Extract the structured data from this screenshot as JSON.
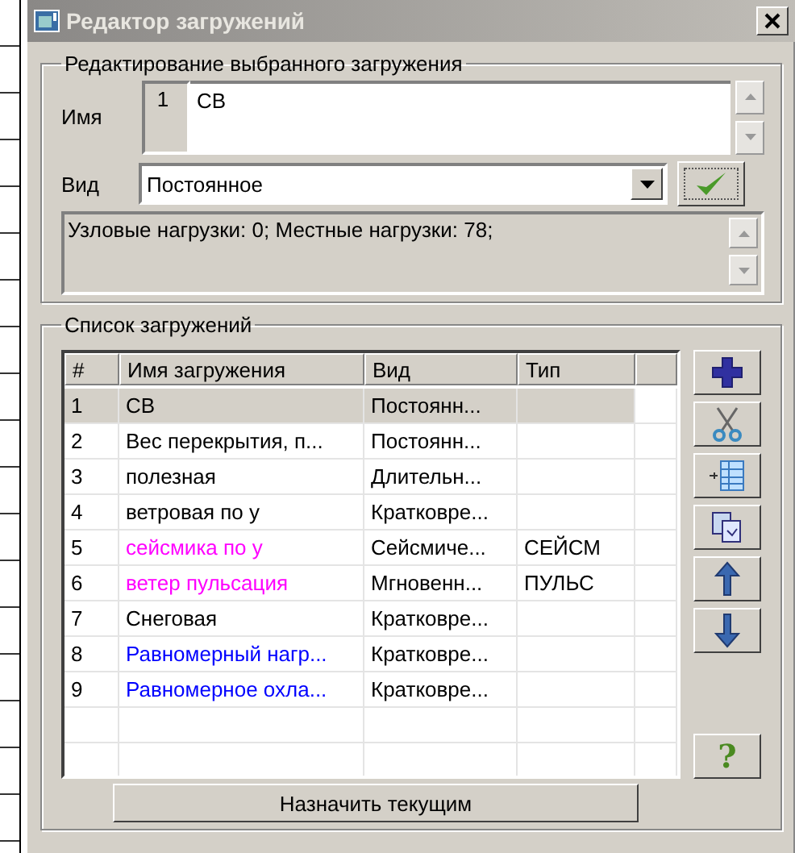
{
  "window": {
    "title": "Редактор загружений"
  },
  "edit_group": {
    "title": "Редактирование выбранного загружения",
    "name_label": "Имя",
    "number": "1",
    "name_value": "СВ",
    "kind_label": "Вид",
    "kind_value": "Постоянное",
    "info": "Узловые нагрузки:  0;  Местные нагрузки:  78;"
  },
  "list_group": {
    "title": "Список загружений",
    "table": {
      "columns": [
        "#",
        "Имя загружения",
        "Вид",
        "Тип"
      ],
      "rows": [
        {
          "cells": [
            "1",
            "СВ",
            "Постоянн...",
            ""
          ],
          "selected": true,
          "color": "#000000"
        },
        {
          "cells": [
            "2",
            "Вес перекрытия, п...",
            "Постоянн...",
            ""
          ],
          "selected": false,
          "color": "#000000"
        },
        {
          "cells": [
            "3",
            "полезная",
            "Длительн...",
            ""
          ],
          "selected": false,
          "color": "#000000"
        },
        {
          "cells": [
            "4",
            "ветровая по у",
            "Кратковре...",
            ""
          ],
          "selected": false,
          "color": "#000000"
        },
        {
          "cells": [
            "5",
            "сейсмика по у",
            "Сейсмиче...",
            "СЕЙСМ"
          ],
          "selected": false,
          "color": "#ff00ff"
        },
        {
          "cells": [
            "6",
            "ветер пульсация",
            "Мгновенн...",
            "ПУЛЬС"
          ],
          "selected": false,
          "color": "#ff00ff"
        },
        {
          "cells": [
            "7",
            "Снеговая",
            "Кратковре...",
            ""
          ],
          "selected": false,
          "color": "#000000"
        },
        {
          "cells": [
            "8",
            "Равномерный нагр...",
            "Кратковре...",
            ""
          ],
          "selected": false,
          "color": "#0000ff"
        },
        {
          "cells": [
            "9",
            "Равномерное охла...",
            "Кратковре...",
            ""
          ],
          "selected": false,
          "color": "#0000ff"
        }
      ]
    },
    "toolbar": [
      {
        "kind": "add"
      },
      {
        "kind": "cut"
      },
      {
        "kind": "insert"
      },
      {
        "kind": "copy"
      },
      {
        "kind": "up"
      },
      {
        "kind": "down"
      },
      {
        "kind": "help",
        "label": "?"
      }
    ],
    "assign_button": "Назначить текущим"
  }
}
